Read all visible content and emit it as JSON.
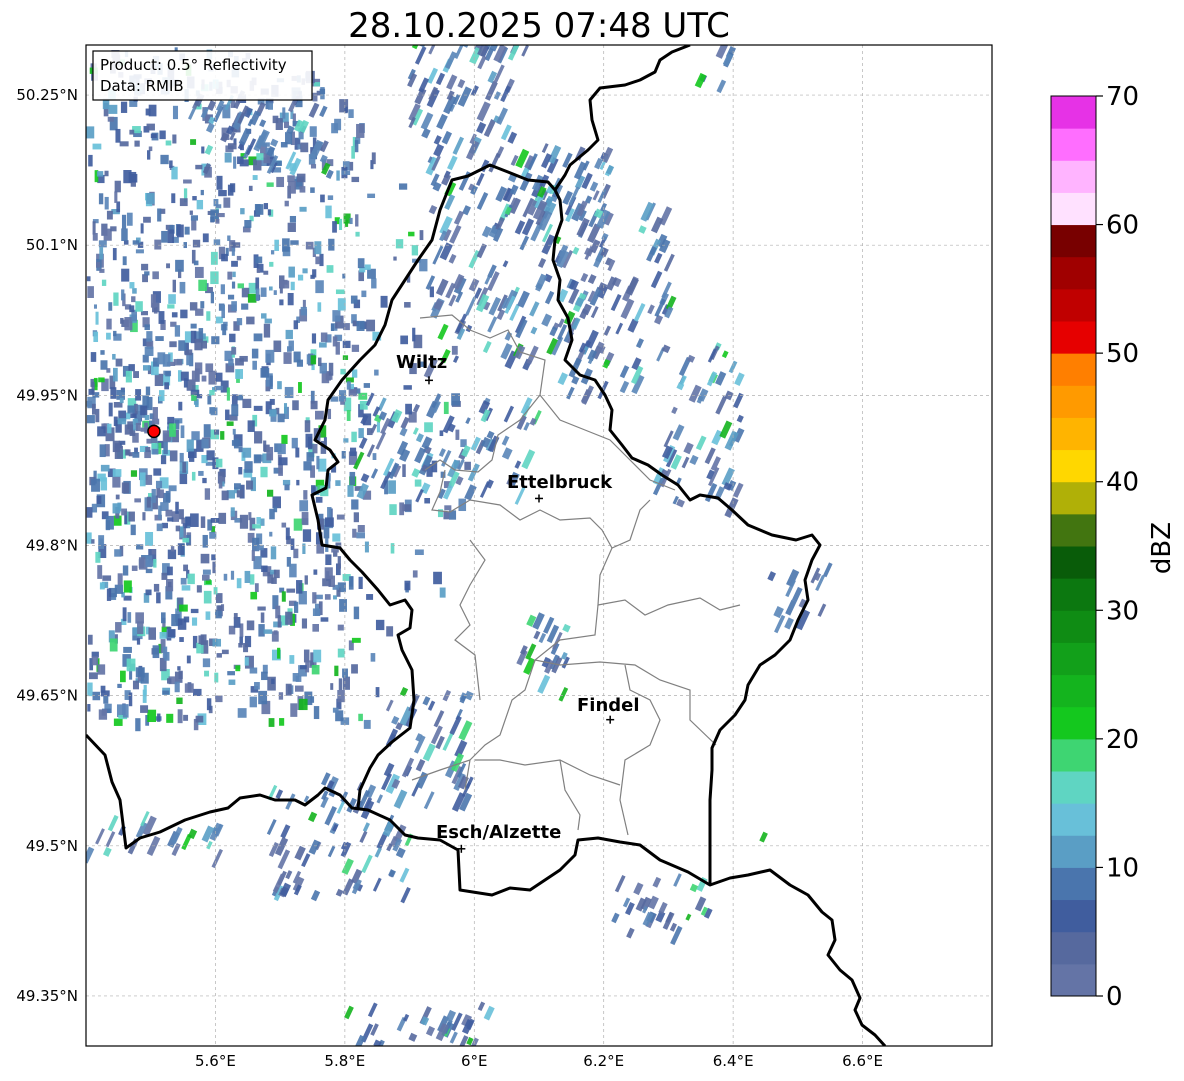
{
  "title": "28.10.2025 07:48 UTC",
  "info_box": {
    "product": "Product: 0.5° Reflectivity",
    "source": "Data: RMIB"
  },
  "map": {
    "lon_range": [
      5.4,
      6.8
    ],
    "lat_range": [
      49.3,
      50.3
    ],
    "lon_ticks": [
      {
        "value": 5.6,
        "label": "5.6°E"
      },
      {
        "value": 5.8,
        "label": "5.8°E"
      },
      {
        "value": 6.0,
        "label": "6°E"
      },
      {
        "value": 6.2,
        "label": "6.2°E"
      },
      {
        "value": 6.4,
        "label": "6.4°E"
      },
      {
        "value": 6.6,
        "label": "6.6°E"
      }
    ],
    "lat_ticks": [
      {
        "value": 50.25,
        "label": "50.25°N"
      },
      {
        "value": 50.1,
        "label": "50.1°N"
      },
      {
        "value": 49.95,
        "label": "49.95°N"
      },
      {
        "value": 49.8,
        "label": "49.8°N"
      },
      {
        "value": 49.65,
        "label": "49.65°N"
      },
      {
        "value": 49.5,
        "label": "49.5°N"
      },
      {
        "value": 49.35,
        "label": "49.35°N"
      }
    ],
    "grid": true,
    "radar_site": {
      "lon": 5.505,
      "lat": 49.914,
      "color": "#ff0000"
    },
    "cities": [
      {
        "name": "Wiltz",
        "lon": 5.93,
        "lat": 49.965
      },
      {
        "name": "Ettelbruck",
        "lon": 6.1,
        "lat": 49.847
      },
      {
        "name": "Findel",
        "lon": 6.21,
        "lat": 49.626
      },
      {
        "name": "Esch/Alzette",
        "lon": 5.98,
        "lat": 49.497
      }
    ]
  },
  "colorbar": {
    "label": "dBZ",
    "min": 0,
    "max": 70,
    "step": 2.5,
    "ticks": [
      {
        "value": 0,
        "label": "0"
      },
      {
        "value": 10,
        "label": "10"
      },
      {
        "value": 20,
        "label": "20"
      },
      {
        "value": 30,
        "label": "30"
      },
      {
        "value": 40,
        "label": "40"
      },
      {
        "value": 50,
        "label": "50"
      },
      {
        "value": 60,
        "label": "60"
      },
      {
        "value": 70,
        "label": "70"
      }
    ],
    "colors": [
      "#6474a6",
      "#56699e",
      "#405d9e",
      "#4a75ad",
      "#5a9ec5",
      "#68c0d9",
      "#5fd5c2",
      "#3ed572",
      "#14c81e",
      "#14b41e",
      "#12a01a",
      "#0f8c14",
      "#0c7810",
      "#095c09",
      "#427510",
      "#b0b007",
      "#ffd700",
      "#ffb400",
      "#ff9a00",
      "#ff7f00",
      "#e60000",
      "#c00000",
      "#a00000",
      "#780000",
      "#ffe1ff",
      "#ffb4ff",
      "#ff6eff",
      "#e632e6"
    ]
  },
  "colors": {
    "border": "#000000",
    "admin_lines": "#808080",
    "grid": "#b0b0b0"
  }
}
